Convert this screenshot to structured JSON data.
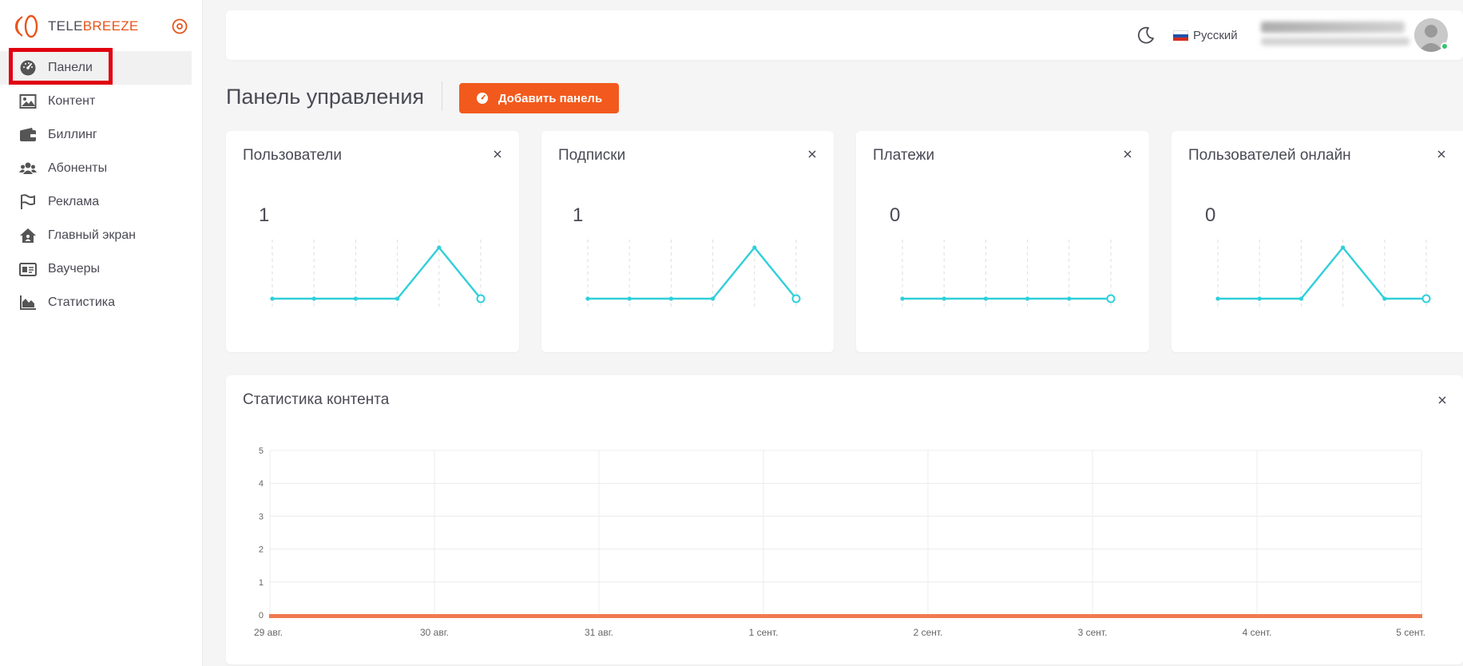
{
  "brand": {
    "name_part1": "TELE",
    "name_part2": "BREEZE",
    "accent": "#e8541a"
  },
  "sidebar": {
    "items": [
      {
        "label": "Панели",
        "icon": "dashboard-gauge-icon",
        "active": true
      },
      {
        "label": "Контент",
        "icon": "image-icon"
      },
      {
        "label": "Биллинг",
        "icon": "wallet-icon"
      },
      {
        "label": "Абоненты",
        "icon": "users-icon"
      },
      {
        "label": "Реклама",
        "icon": "flag-icon"
      },
      {
        "label": "Главный экран",
        "icon": "home-icon"
      },
      {
        "label": "Ваучеры",
        "icon": "voucher-card-icon"
      },
      {
        "label": "Статистика",
        "icon": "area-chart-icon"
      }
    ]
  },
  "header": {
    "language": "Русский",
    "theme_icon": "moon-icon"
  },
  "page": {
    "title": "Панель управления",
    "add_button": "Добавить панель"
  },
  "cards": [
    {
      "title": "Пользователи",
      "value": "1"
    },
    {
      "title": "Подписки",
      "value": "1"
    },
    {
      "title": "Платежи",
      "value": "0"
    },
    {
      "title": "Пользователей онлайн",
      "value": "0"
    }
  ],
  "content_stats": {
    "title": "Статистика контента"
  },
  "chart_data": [
    {
      "type": "line",
      "x": [
        1,
        2,
        3,
        4,
        5,
        6
      ],
      "y": [
        0,
        0,
        0,
        0,
        1,
        0
      ],
      "color": "#2fcfd9"
    },
    {
      "type": "line",
      "x": [
        1,
        2,
        3,
        4,
        5,
        6
      ],
      "y": [
        0,
        0,
        0,
        0,
        1,
        0
      ],
      "color": "#2fcfd9"
    },
    {
      "type": "line",
      "x": [
        1,
        2,
        3,
        4,
        5,
        6
      ],
      "y": [
        0,
        0,
        0,
        0,
        0,
        0
      ],
      "color": "#2fcfd9"
    },
    {
      "type": "line",
      "x": [
        1,
        2,
        3,
        4,
        5,
        6
      ],
      "y": [
        0,
        0,
        0,
        1,
        0,
        0
      ],
      "color": "#2fcfd9"
    },
    {
      "type": "area",
      "categories": [
        "29 авг.",
        "30 авг.",
        "31 авг.",
        "1 сент.",
        "2 сент.",
        "3 сент.",
        "4 сент.",
        "5 сент."
      ],
      "y_ticks": [
        "0",
        "1",
        "2",
        "3",
        "4",
        "5"
      ],
      "ylim": [
        0,
        5
      ],
      "series": [
        {
          "values": [
            0,
            0,
            0,
            0,
            0,
            0,
            0,
            0
          ],
          "color": "#f07a50"
        }
      ],
      "grid": true
    }
  ]
}
